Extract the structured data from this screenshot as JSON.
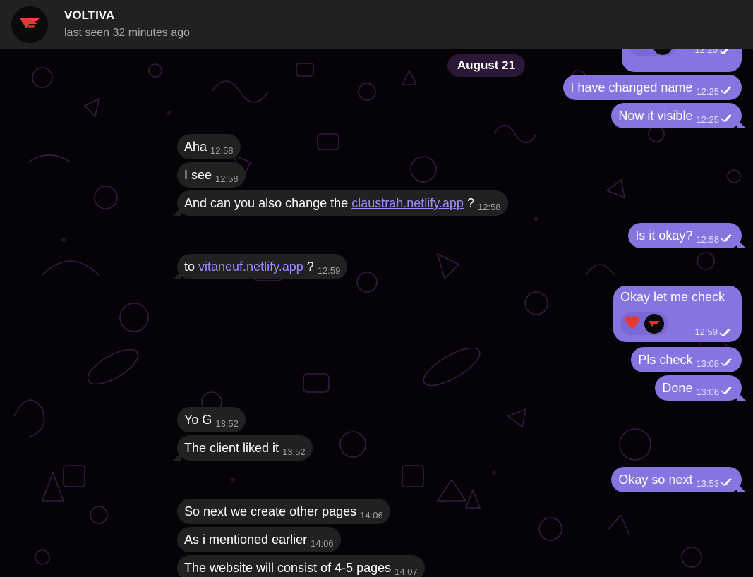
{
  "header": {
    "title": "VOLTIVA",
    "status": "last seen 32 minutes ago",
    "avatar_icon": "voltiva-logo-icon"
  },
  "date_separator": "August 21",
  "messages": [
    {
      "dir": "out",
      "text": "",
      "reactions": [
        "heart-icon",
        "voltiva-avatar-icon"
      ],
      "time": "12:25",
      "read": true
    },
    {
      "dir": "out",
      "text": "I have changed name",
      "time": "12:25",
      "read": true
    },
    {
      "dir": "out",
      "text": "Now it visible",
      "time": "12:25",
      "read": true
    },
    {
      "dir": "in",
      "text": "Aha",
      "time": "12:58"
    },
    {
      "dir": "in",
      "text": "I see",
      "time": "12:58"
    },
    {
      "dir": "in",
      "text_before": "And can you also change the ",
      "link": "claustrah.netlify.app",
      "text_after": " ?",
      "time": "12:58"
    },
    {
      "dir": "out",
      "text": "Is it okay?",
      "time": "12:58",
      "read": true
    },
    {
      "dir": "in",
      "text_before": "to ",
      "link": "vitaneuf.netlify.app",
      "text_after": " ?",
      "time": "12:59"
    },
    {
      "dir": "out",
      "text": "Okay let me check",
      "reactions": [
        "heart-icon",
        "voltiva-avatar-icon"
      ],
      "time": "12:59",
      "read": true
    },
    {
      "dir": "out",
      "text": "Pls check",
      "time": "13:08",
      "read": true
    },
    {
      "dir": "out",
      "text": "Done",
      "time": "13:08",
      "read": true
    },
    {
      "dir": "in",
      "text": "Yo G",
      "time": "13:52"
    },
    {
      "dir": "in",
      "text": "The client liked it",
      "time": "13:52"
    },
    {
      "dir": "out",
      "text": "Okay so next",
      "time": "13:53",
      "read": true
    },
    {
      "dir": "in",
      "text": "So next we create other pages",
      "time": "14:06"
    },
    {
      "dir": "in",
      "text": "As i mentioned earlier",
      "time": "14:06"
    },
    {
      "dir": "in",
      "text": "The website will consist of 4-5 pages",
      "time": "14:07"
    }
  ],
  "colors": {
    "outgoing_bubble": "#8774e1",
    "incoming_bubble": "#212121",
    "header_bg": "#212121",
    "date_pill": "#2b1836",
    "heart": "#e53935",
    "logo": "#e53935"
  }
}
